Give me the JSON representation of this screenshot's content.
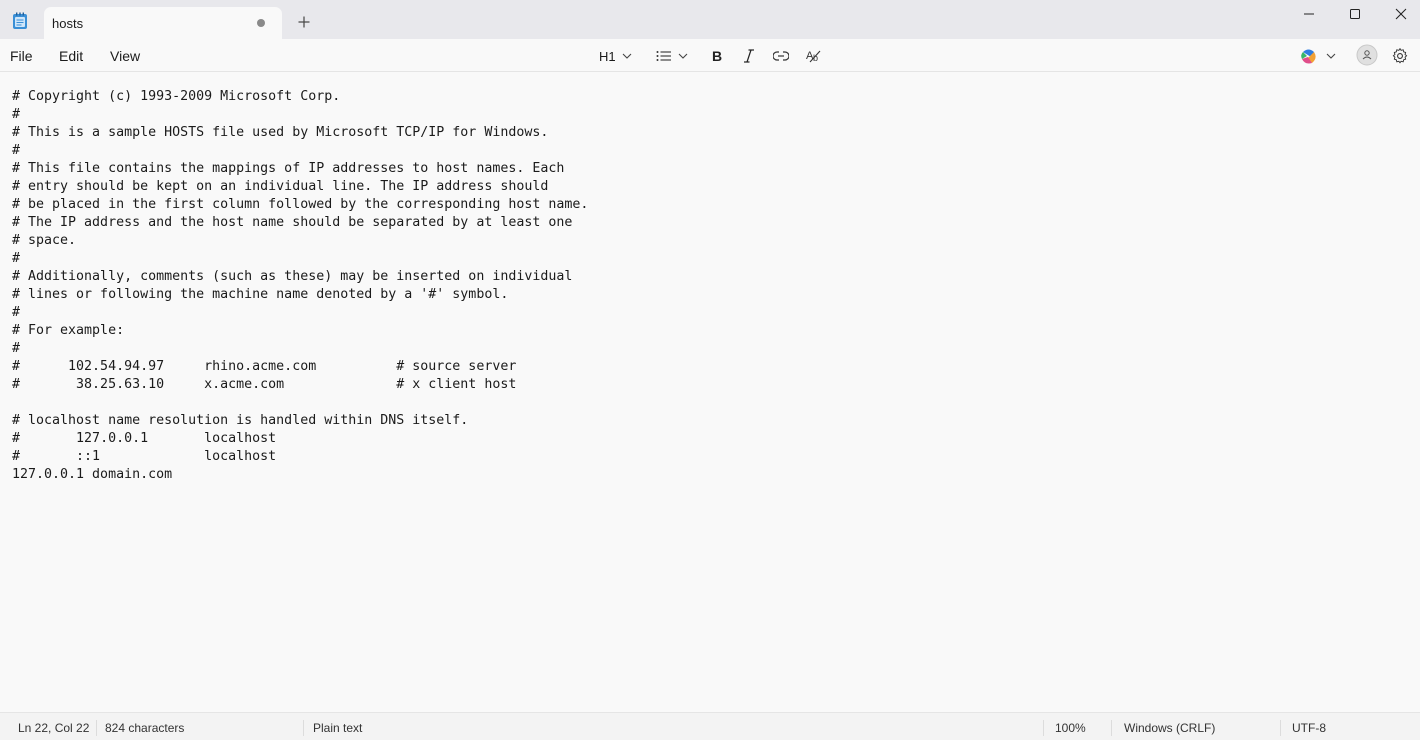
{
  "tab": {
    "title": "hosts"
  },
  "menu": {
    "file": "File",
    "edit": "Edit",
    "view": "View"
  },
  "toolbar": {
    "heading": "H1"
  },
  "editor": {
    "content": "# Copyright (c) 1993-2009 Microsoft Corp.\n#\n# This is a sample HOSTS file used by Microsoft TCP/IP for Windows.\n#\n# This file contains the mappings of IP addresses to host names. Each\n# entry should be kept on an individual line. The IP address should\n# be placed in the first column followed by the corresponding host name.\n# The IP address and the host name should be separated by at least one\n# space.\n#\n# Additionally, comments (such as these) may be inserted on individual\n# lines or following the machine name denoted by a '#' symbol.\n#\n# For example:\n#\n#      102.54.94.97     rhino.acme.com          # source server\n#       38.25.63.10     x.acme.com              # x client host\n\n# localhost name resolution is handled within DNS itself.\n#\t127.0.0.1       localhost\n#\t::1             localhost\n127.0.0.1 domain.com"
  },
  "status": {
    "position": "Ln 22, Col 22",
    "characters": "824 characters",
    "format": "Plain text",
    "zoom": "100%",
    "line_ending": "Windows (CRLF)",
    "encoding": "UTF-8"
  }
}
